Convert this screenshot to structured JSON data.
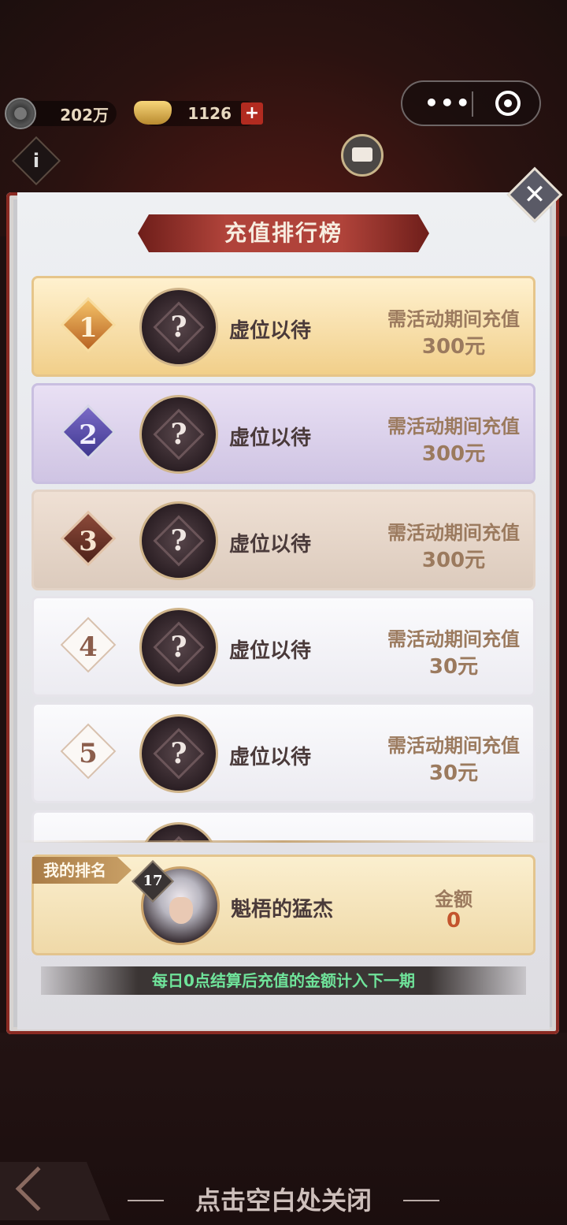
{
  "resources": [
    {
      "icon": "coin-icon",
      "value": "202万"
    },
    {
      "icon": "gold-ingot-icon",
      "value": "1126",
      "add_label": "+"
    }
  ],
  "capsule": {
    "menu_label": "•••"
  },
  "title": "充值排行榜",
  "close_label": "✕",
  "ranks": [
    {
      "rank": "1",
      "name": "虚位以待",
      "req_label": "需活动期间充值",
      "req_amount": "300元",
      "avatar": "?"
    },
    {
      "rank": "2",
      "name": "虚位以待",
      "req_label": "需活动期间充值",
      "req_amount": "300元",
      "avatar": "?"
    },
    {
      "rank": "3",
      "name": "虚位以待",
      "req_label": "需活动期间充值",
      "req_amount": "300元",
      "avatar": "?"
    },
    {
      "rank": "4",
      "name": "虚位以待",
      "req_label": "需活动期间充值",
      "req_amount": "30元",
      "avatar": "?"
    },
    {
      "rank": "5",
      "name": "虚位以待",
      "req_label": "需活动期间充值",
      "req_amount": "30元",
      "avatar": "?"
    }
  ],
  "my_rank": {
    "tag": "我的排名",
    "level": "17",
    "name": "魁梧的猛杰",
    "amount_label": "金额",
    "amount_value": "0"
  },
  "note": "每日0点结算后充值的金额计入下一期",
  "bottom_hint": "点击空白处关闭",
  "info_label": "i"
}
